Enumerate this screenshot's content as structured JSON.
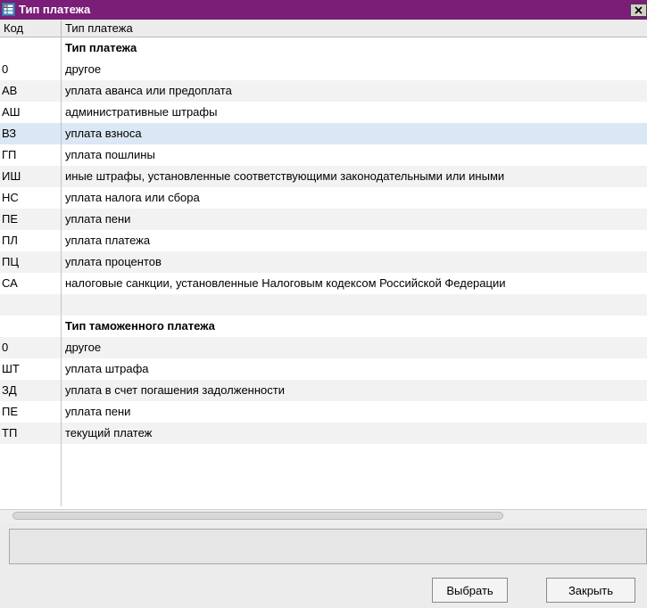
{
  "window": {
    "title": "Тип платежа",
    "icons": {
      "app": "table-icon",
      "close": "close-icon"
    },
    "colors": {
      "titlebar": "#7a1e78",
      "selected_row": "#dae7f5",
      "alt_row": "#f2f2f2"
    }
  },
  "grid": {
    "columns": [
      "Код",
      "Тип платежа"
    ],
    "rows": [
      {
        "code": "",
        "name": "Тип платежа",
        "group": true
      },
      {
        "code": "0",
        "name": "другое"
      },
      {
        "code": "АВ",
        "name": "уплата аванса или предоплата"
      },
      {
        "code": "АШ",
        "name": "административные штрафы"
      },
      {
        "code": "ВЗ",
        "name": "уплата взноса",
        "selected": true
      },
      {
        "code": "ГП",
        "name": "уплата пошлины"
      },
      {
        "code": "ИШ",
        "name": "иные штрафы, установленные соответствующими законодательными или иными"
      },
      {
        "code": "НС",
        "name": "уплата налога или сбора"
      },
      {
        "code": "ПЕ",
        "name": "уплата пени"
      },
      {
        "code": "ПЛ",
        "name": "уплата платежа"
      },
      {
        "code": "ПЦ",
        "name": "уплата процентов"
      },
      {
        "code": "СА",
        "name": "налоговые санкции, установленные Налоговым кодексом Российской Федерации"
      },
      {
        "code": "",
        "name": ""
      },
      {
        "code": "",
        "name": "Тип таможенного платежа",
        "group": true
      },
      {
        "code": "0",
        "name": "другое"
      },
      {
        "code": "ШТ",
        "name": "уплата штрафа"
      },
      {
        "code": "ЗД",
        "name": "уплата в счет погашения задолженности"
      },
      {
        "code": "ПЕ",
        "name": "уплата пени"
      },
      {
        "code": "ТП",
        "name": "текущий платеж"
      }
    ]
  },
  "buttons": {
    "select": "Выбрать",
    "close": "Закрыть"
  }
}
